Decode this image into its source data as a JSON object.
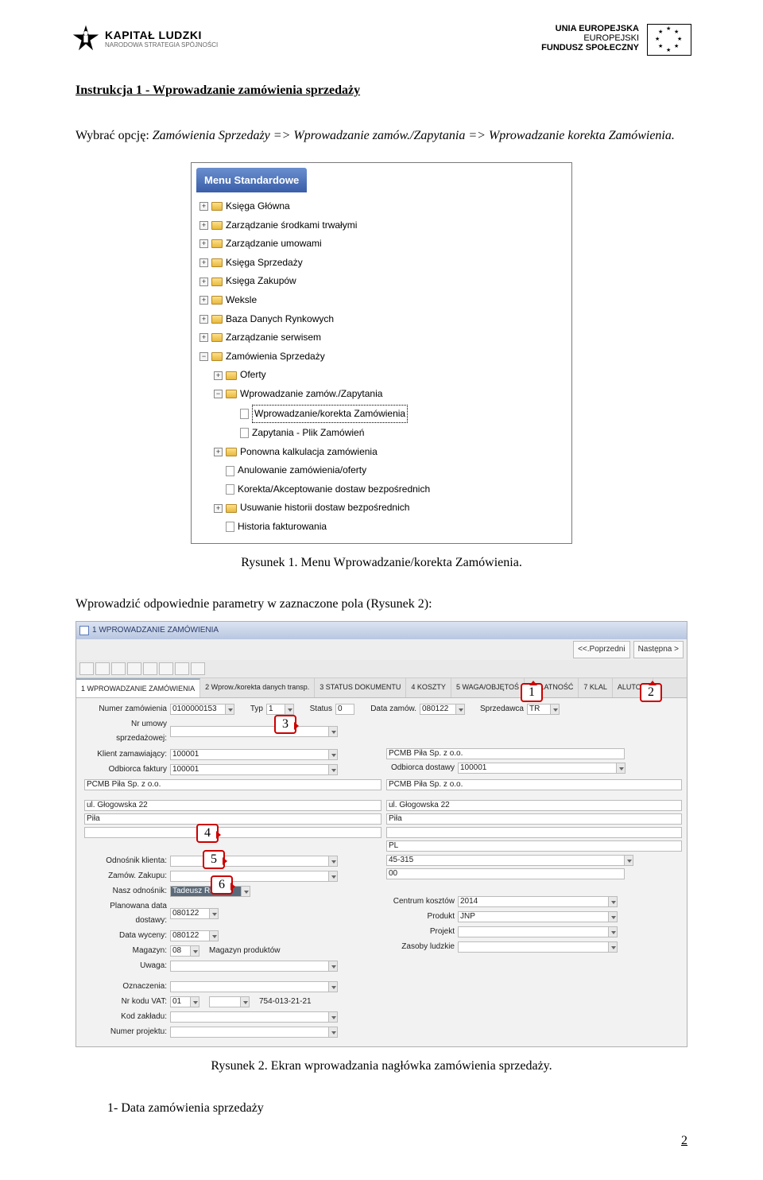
{
  "header": {
    "left": {
      "line1": "KAPITAŁ LUDZKI",
      "line2": "NARODOWA STRATEGIA SPÓJNOŚCI"
    },
    "right": {
      "line1": "UNIA EUROPEJSKA",
      "line2": "EUROPEJSKI",
      "line3": "FUNDUSZ SPOŁECZNY"
    }
  },
  "title": "Instrukcja 1 - Wprowadzanie zamówienia sprzedaży",
  "instruction": {
    "lead": "Wybrać opcję:",
    "path": "Zamówienia Sprzedaży => Wprowadzanie zamów./Zapytania => Wprowadzanie korekta Zamówienia."
  },
  "menu": {
    "title": "Menu Standardowe",
    "items": [
      {
        "label": "Księga Główna",
        "depth": 0,
        "type": "folder",
        "exp": "+"
      },
      {
        "label": "Zarządzanie środkami trwałymi",
        "depth": 0,
        "type": "folder",
        "exp": "+"
      },
      {
        "label": "Zarządzanie umowami",
        "depth": 0,
        "type": "folder",
        "exp": "+"
      },
      {
        "label": "Księga Sprzedaży",
        "depth": 0,
        "type": "folder",
        "exp": "+"
      },
      {
        "label": "Księga Zakupów",
        "depth": 0,
        "type": "folder",
        "exp": "+"
      },
      {
        "label": "Weksle",
        "depth": 0,
        "type": "folder",
        "exp": "+"
      },
      {
        "label": "Baza Danych Rynkowych",
        "depth": 0,
        "type": "folder",
        "exp": "+"
      },
      {
        "label": "Zarządzanie serwisem",
        "depth": 0,
        "type": "folder",
        "exp": "+"
      },
      {
        "label": "Zamówienia Sprzedaży",
        "depth": 0,
        "type": "folder",
        "exp": "−"
      },
      {
        "label": "Oferty",
        "depth": 1,
        "type": "folder",
        "exp": "+"
      },
      {
        "label": "Wprowadzanie zamów./Zapytania",
        "depth": 1,
        "type": "folder",
        "exp": "−"
      },
      {
        "label": "Wprowadzanie/korekta Zamówienia",
        "depth": 2,
        "type": "page",
        "sel": true
      },
      {
        "label": "Zapytania - Plik Zamówień",
        "depth": 2,
        "type": "page"
      },
      {
        "label": "Ponowna kalkulacja zamówienia",
        "depth": 1,
        "type": "folder",
        "exp": "+"
      },
      {
        "label": "Anulowanie zamówienia/oferty",
        "depth": 1,
        "type": "page"
      },
      {
        "label": "Korekta/Akceptowanie dostaw bezpośrednich",
        "depth": 1,
        "type": "page"
      },
      {
        "label": "Usuwanie historii dostaw bezpośrednich",
        "depth": 1,
        "type": "folder",
        "exp": "+"
      },
      {
        "label": "Historia fakturowania",
        "depth": 1,
        "type": "page"
      }
    ]
  },
  "caption1": "Rysunek 1. Menu Wprowadzanie/korekta Zamówienia.",
  "para2": "Wprowadzić odpowiednie parametry w zaznaczone pola (Rysunek 2):",
  "form": {
    "bar": "1 WPROWADZANIE ZAMÓWIENIA",
    "nav_prev": "<<.Poprzedni",
    "nav_next": "Następna >",
    "tabs": [
      "1 WPROWADZANIE ZAMÓWIENIA",
      "2 Wprow./korekta danych transp.",
      "3 STATUS DOKUMENTU",
      "4 KOSZTY",
      "5 WAGA/OBJĘTOŚ",
      "6 PŁATNOŚĆ",
      "7 KLAL",
      "ALUTOW"
    ],
    "fields": {
      "numer": "Numer zamówienia",
      "numer_v": "0100000153",
      "typ": "Typ",
      "typ_v": "1",
      "status": "Status",
      "status_v": "0",
      "data_zamow": "Data zamów.",
      "data_zamow_v": "080122",
      "sprzedawca": "Sprzedawca",
      "sprzedawca_v": "TR",
      "nr_umowy": "Nr umowy sprzedażowej:",
      "klient": "Klient zamawiający:",
      "klient_v": "100001",
      "pcmb": "PCMB Piła Sp. z o.o.",
      "odbiorca": "Odbiorca faktury",
      "odbiorca_v": "100001",
      "odb_dostawy": "Odbiorca dostawy",
      "odb_dostawy_v": "100001",
      "adres1": "ul. Głogowska 22",
      "adres2": "Piła",
      "pl": "PL",
      "odnosnik": "Odnośnik klienta:",
      "kod45": "45-315",
      "zamow_zakupu": "Zamów. Zakupu:",
      "zero0": "00",
      "nasz": "Nasz odnośnik:",
      "nasz_v": "Tadeusz Różew",
      "plan": "Planowana data dostawy:",
      "plan_v": "080122",
      "centrum": "Centrum kosztów",
      "centrum_v": "2014",
      "data_wyc": "Data wyceny:",
      "data_wyc_v": "080122",
      "produkt": "Produkt",
      "produkt_v": "JNP",
      "magazyn": "Magazyn:",
      "magazyn_v": "08",
      "magazyn_t": "Magazyn produktów",
      "projekt": "Projekt",
      "uwaga": "Uwaga:",
      "zasoby": "Zasoby ludzkie",
      "ozn": "Oznaczenia:",
      "vat": "Nr kodu VAT:",
      "vat_v": "01",
      "vat_t": "754-013-21-21",
      "kod_zakl": "Kod zakładu:",
      "nr_proj": "Numer projektu:"
    }
  },
  "callouts": {
    "c1": "1",
    "c2": "2",
    "c3": "3",
    "c4": "4",
    "c5": "5",
    "c6": "6"
  },
  "caption2": "Rysunek 2. Ekran wprowadzania  nagłówka zamówienia sprzedaży.",
  "list_item1": "1-   Data zamówienia sprzedaży",
  "page_number": "2"
}
